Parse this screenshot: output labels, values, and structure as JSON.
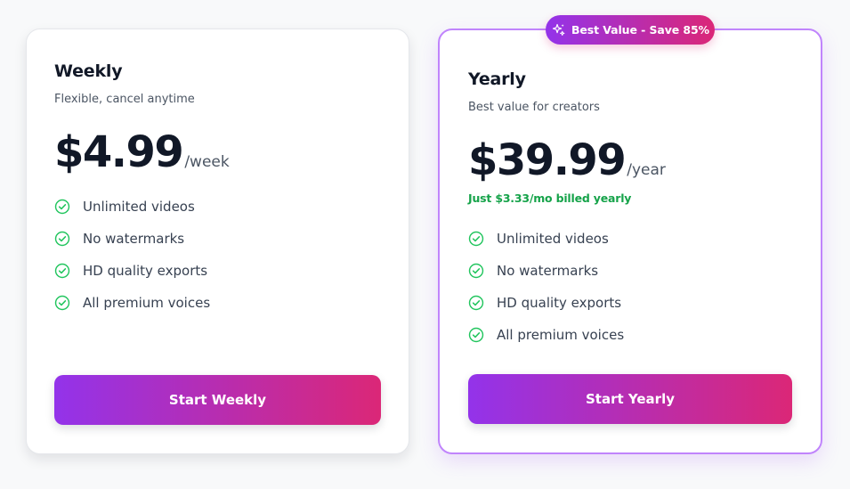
{
  "weekly": {
    "name": "Weekly",
    "description": "Flexible, cancel anytime",
    "price": "$4.99",
    "period": "/week",
    "features": [
      "Unlimited videos",
      "No watermarks",
      "HD quality exports",
      "All premium voices"
    ],
    "cta": "Start Weekly"
  },
  "yearly": {
    "badge": "Best Value - Save 85%",
    "name": "Yearly",
    "description": "Best value for creators",
    "price": "$39.99",
    "period": "/year",
    "billing_note": "Just $3.33/mo billed yearly",
    "features": [
      "Unlimited videos",
      "No watermarks",
      "HD quality exports",
      "All premium voices"
    ],
    "cta": "Start Yearly"
  },
  "icons": {
    "feature": "check-circle-icon",
    "badge": "sparkles-icon"
  },
  "colors": {
    "accent_start": "#9333ea",
    "accent_end": "#db2777",
    "check": "#22c55e",
    "highlight_border": "#c084fc",
    "billing_note": "#16a34a"
  }
}
